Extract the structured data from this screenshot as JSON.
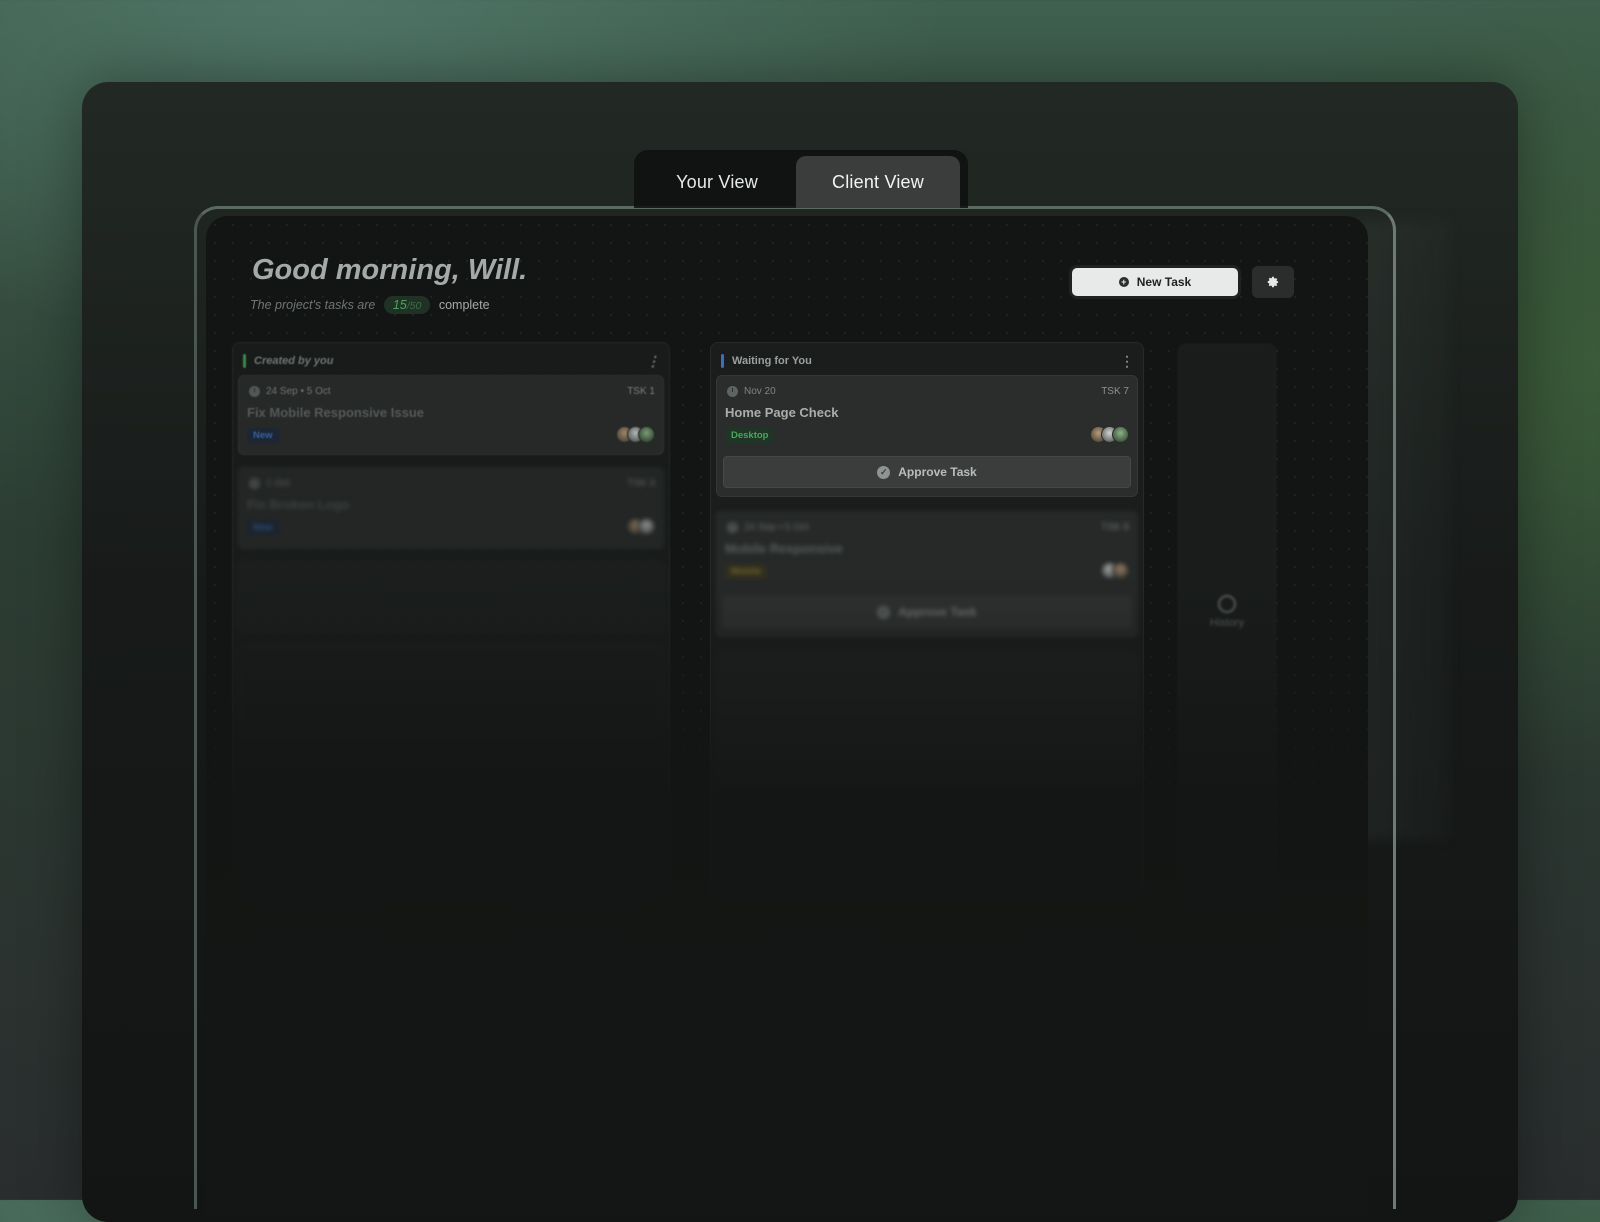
{
  "tabs": {
    "your_view": "Your View",
    "client_view": "Client View",
    "active": "Client View"
  },
  "header": {
    "greeting": "Good morning, Will.",
    "progress_prefix": "The project's tasks are",
    "progress_done": "15",
    "progress_total": "/50",
    "progress_suffix": "complete",
    "new_task_label": "New Task"
  },
  "icons": {
    "settings": "gear-icon",
    "new_task": "plus-icon",
    "approve": "check-circle-icon",
    "date": "clock-icon",
    "history": "history-icon"
  },
  "colors": {
    "created_accent": "#3f9a4e",
    "waiting_accent": "#3d6fb8",
    "desktop_tag_bg": "#1f3526",
    "desktop_tag_text": "#48a858"
  },
  "columns": {
    "created": {
      "title": "Created by you",
      "cards": [
        {
          "date": "24 Sep • 5 Oct",
          "id": "TSK 1",
          "title": "Fix Mobile Responsive Issue",
          "tag": "New"
        },
        {
          "date": "1 Oct",
          "id": "TSK 3",
          "title": "Fix Broken Logo",
          "tag": "New"
        }
      ]
    },
    "waiting": {
      "title": "Waiting for You",
      "cards": [
        {
          "date": "Nov 20",
          "id": "TSK 7",
          "title": "Home Page Check",
          "tag": "Desktop",
          "action": "Approve Task"
        },
        {
          "date": "24 Sep • 5 Oct",
          "id": "TSK 8",
          "title": "Mobile Responsive",
          "tag": "Mobile",
          "action": "Approve Task"
        }
      ]
    },
    "history": {
      "label": "History"
    }
  }
}
